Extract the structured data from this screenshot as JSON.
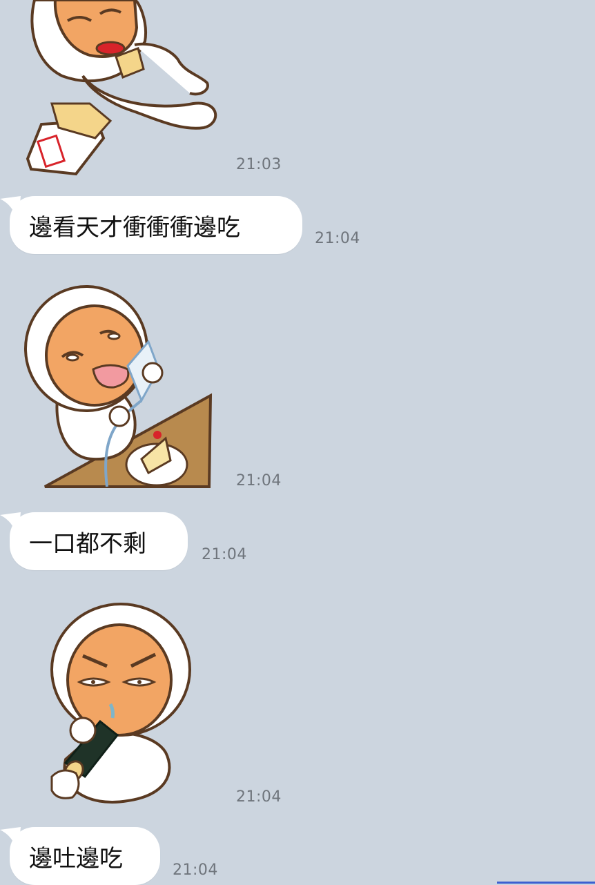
{
  "messages": [
    {
      "type": "sticker",
      "sticker": "baby-lying-eating-chips-sticker",
      "time": "21:03"
    },
    {
      "type": "text",
      "text": "邊看天才衝衝衝邊吃",
      "time": "21:04"
    },
    {
      "type": "sticker",
      "sticker": "baby-licking-cake-wrapper-sticker",
      "time": "21:04"
    },
    {
      "type": "text",
      "text": "一口都不剩",
      "time": "21:04"
    },
    {
      "type": "sticker",
      "sticker": "baby-eating-sushi-roll-sticker",
      "time": "21:04"
    },
    {
      "type": "text",
      "text": "邊吐邊吃",
      "time": "21:04"
    }
  ],
  "colors": {
    "background": "#ccd5df",
    "bubble": "#ffffff",
    "timestamp": "#6f757c",
    "skin": "#f2a564",
    "hood": "#ffffff",
    "outline": "#5a3a22",
    "table": "#b88a4e"
  }
}
